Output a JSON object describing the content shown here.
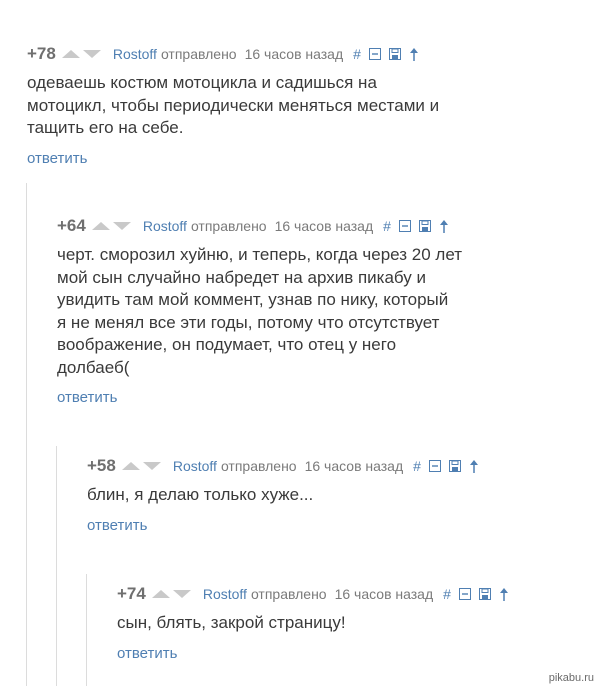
{
  "comments": [
    {
      "score": "+78",
      "author": "Rostoff",
      "sent": "отправлено",
      "time": "16 часов назад",
      "hash": "#",
      "lines": [
        "одеваешь костюм мотоцикла и садишься на",
        "мотоцикл, чтобы периодически меняться местами и",
        "тащить его на себе."
      ],
      "reply": "ответить"
    },
    {
      "score": "+64",
      "author": "Rostoff",
      "sent": "отправлено",
      "time": "16 часов назад",
      "hash": "#",
      "lines": [
        "черт. сморозил хуйню, и теперь, когда через 20 лет",
        "мой сын случайно набредет на архив пикабу и",
        "увидить там мой коммент, узнав по нику, который",
        "я не менял все эти годы, потому что отсутствует",
        "воображение, он подумает, что отец у него",
        "долбаеб("
      ],
      "reply": "ответить"
    },
    {
      "score": "+58",
      "author": "Rostoff",
      "sent": "отправлено",
      "time": "16 часов назад",
      "hash": "#",
      "lines": [
        "блин, я делаю только хуже..."
      ],
      "reply": "ответить"
    },
    {
      "score": "+74",
      "author": "Rostoff",
      "sent": "отправлено",
      "time": "16 часов назад",
      "hash": "#",
      "lines": [
        "сын, блять, закрой страницу!"
      ],
      "reply": "ответить"
    }
  ],
  "watermark": "pikabu.ru",
  "colors": {
    "link": "#4f7fb2",
    "text": "#3a3a3a",
    "muted": "#7a7a7a",
    "arrow": "#c9c9c9"
  }
}
